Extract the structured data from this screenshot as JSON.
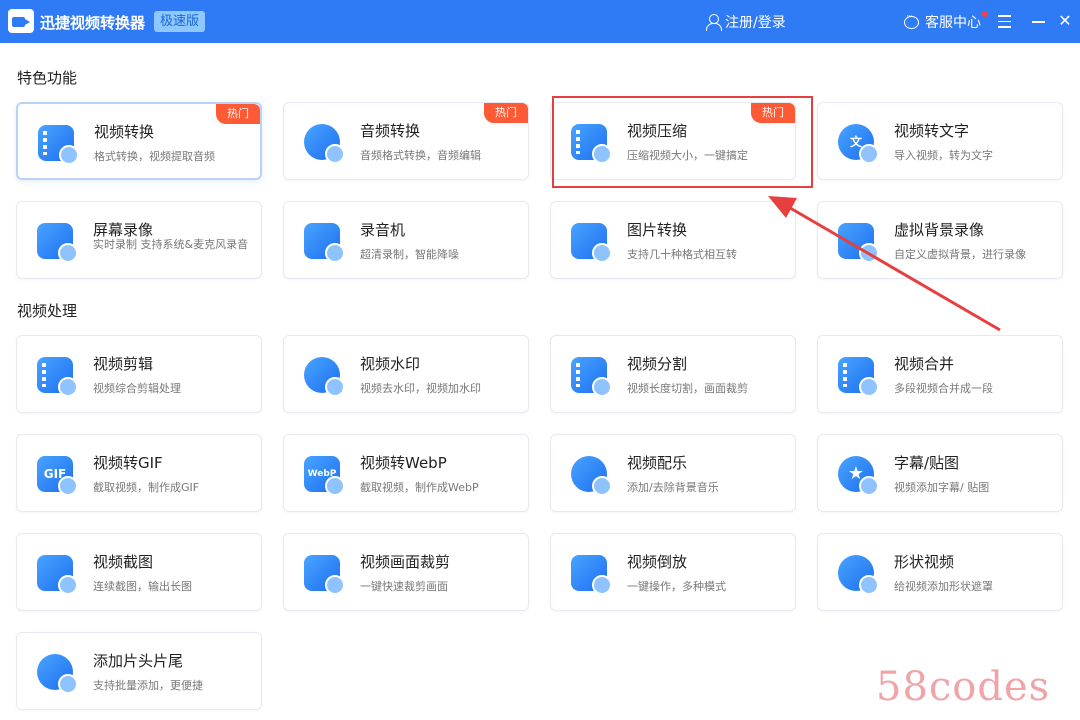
{
  "app": {
    "title": "迅捷视频转换器",
    "edition": "极速版",
    "login": "注册/登录",
    "service": "客服中心",
    "close": "✕",
    "accent_color": "#2f7bf6",
    "hot_color": "#ff5a36"
  },
  "sections": {
    "featured": "特色功能",
    "processing": "视频处理"
  },
  "cards": [
    {
      "title": "视频转换",
      "desc": "格式转换，视频提取音频",
      "hot": "热门",
      "icon": "video-convert-icon"
    },
    {
      "title": "音频转换",
      "desc": "音频格式转换，音频编辑",
      "hot": "热门",
      "icon": "audio-convert-icon"
    },
    {
      "title": "视频压缩",
      "desc": "压缩视频大小，一键搞定",
      "hot": "热门",
      "icon": "video-compress-icon"
    },
    {
      "title": "视频转文字",
      "desc": "导入视频，转为文字",
      "mark": "文",
      "icon": "video-to-text-icon"
    },
    {
      "title": "屏幕录像",
      "desc": "实时录制 支持系统&麦克风录音",
      "icon": "screen-record-icon"
    },
    {
      "title": "录音机",
      "desc": "超清录制，智能降噪",
      "icon": "recorder-icon"
    },
    {
      "title": "图片转换",
      "desc": "支持几十种格式相互转",
      "icon": "image-convert-icon"
    },
    {
      "title": "虚拟背景录像",
      "desc": "自定义虚拟背景，进行录像",
      "icon": "virtual-background-icon"
    },
    {
      "title": "视频剪辑",
      "desc": "视频综合剪辑处理",
      "icon": "video-edit-icon"
    },
    {
      "title": "视频水印",
      "desc": "视频去水印，视频加水印",
      "icon": "video-watermark-icon"
    },
    {
      "title": "视频分割",
      "desc": "视频长度切割，画面裁剪",
      "icon": "video-split-icon"
    },
    {
      "title": "视频合并",
      "desc": "多段视频合并成一段",
      "icon": "video-merge-icon"
    },
    {
      "title": "视频转GIF",
      "desc": "截取视频，制作成GIF",
      "mark": "GIF",
      "icon": "video-to-gif-icon"
    },
    {
      "title": "视频转WebP",
      "desc": "截取视频，制作成WebP",
      "mark": "WebP",
      "icon": "video-to-webp-icon"
    },
    {
      "title": "视频配乐",
      "desc": "添加/去除背景音乐",
      "icon": "video-music-icon"
    },
    {
      "title": "字幕/贴图",
      "desc": "视频添加字幕/ 贴图",
      "mark": "★",
      "icon": "subtitle-sticker-icon"
    },
    {
      "title": "视频截图",
      "desc": "连续截图，输出长图",
      "icon": "video-screenshot-icon"
    },
    {
      "title": "视频画面裁剪",
      "desc": "一键快速裁剪画面",
      "icon": "video-crop-icon"
    },
    {
      "title": "视频倒放",
      "desc": "一键操作，多种模式",
      "icon": "video-reverse-icon"
    },
    {
      "title": "形状视频",
      "desc": "给视频添加形状遮罩",
      "icon": "shape-video-icon"
    },
    {
      "title": "添加片头片尾",
      "desc": "支持批量添加，更便捷",
      "icon": "add-intro-outro-icon"
    }
  ],
  "watermark": "58codes"
}
